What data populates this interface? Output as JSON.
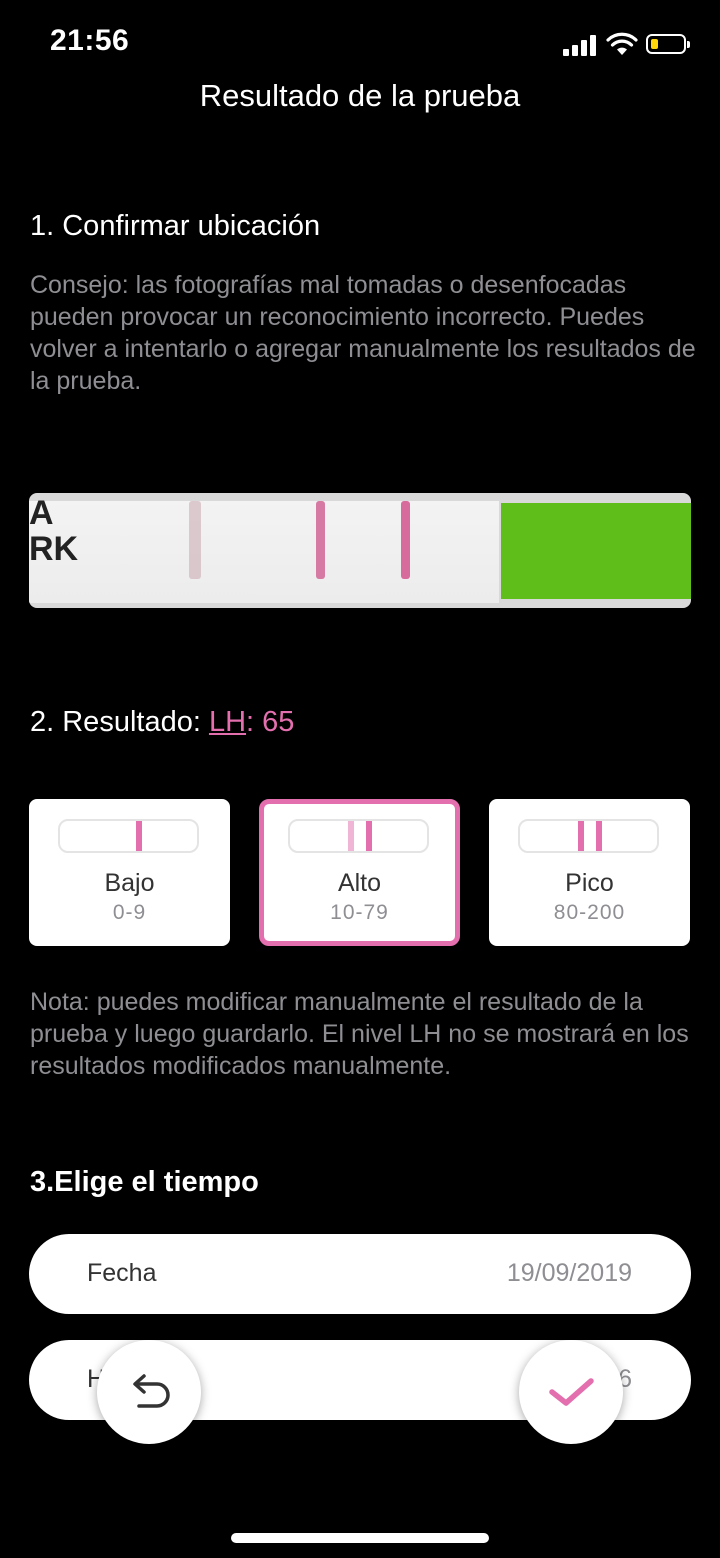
{
  "status": {
    "time": "21:56"
  },
  "title": "Resultado de la prueba",
  "section1": {
    "heading": "1. Confirmar ubicación",
    "tip": "Consejo: las fotografías mal tomadas o desenfocadas pueden provocar un reconocimiento incorrecto. Puedes volver a intentarlo o agregar manualmente los resultados de la prueba."
  },
  "strip": {
    "text_line1": "A",
    "text_line2": "RK"
  },
  "section2": {
    "label": "2. Resultado: ",
    "lh": "LH",
    "colon": ": ",
    "value": "65"
  },
  "levels": [
    {
      "label": "Bajo",
      "range": "0-9",
      "selected": false
    },
    {
      "label": "Alto",
      "range": "10-79",
      "selected": true
    },
    {
      "label": "Pico",
      "range": "80-200",
      "selected": false
    }
  ],
  "note": "Nota: puedes modificar manualmente el resultado de la prueba y luego guardarlo. El nivel LH no se mostrará en los resultados modificados manualmente.",
  "section3": {
    "heading": "3.Elige el tiempo",
    "date_label": "Fecha",
    "date_value": "19/09/2019",
    "time_label": "H",
    "time_value": "6"
  },
  "colors": {
    "accent": "#e36fae",
    "background": "#000000",
    "strip_green": "#5fbe1a"
  },
  "icons": {
    "back": "undo-arrow-icon",
    "confirm": "checkmark-icon"
  }
}
